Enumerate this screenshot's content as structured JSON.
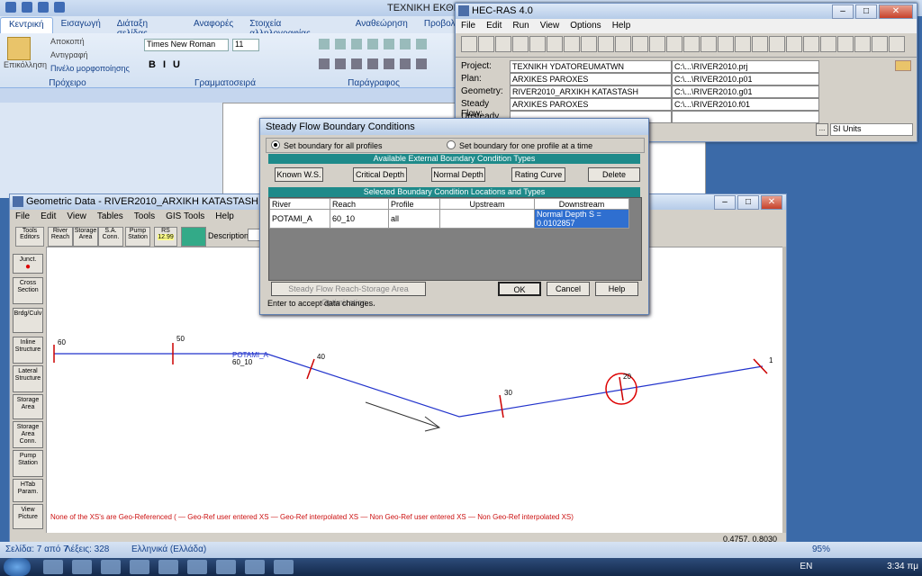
{
  "word": {
    "title": "ΤΕΧΝΙΚΗ ΕΚΘΕΣΗ",
    "tabs": [
      "Κεντρική",
      "Εισαγωγή",
      "Διάταξη σελίδας",
      "Αναφορές",
      "Στοιχεία αλληλογραφίας",
      "Αναθεώρηση",
      "Προβολή"
    ],
    "clipboard": {
      "paste": "Επικόλληση",
      "cut": "Αποκοπή",
      "copy": "Αντιγραφή",
      "format_painter": "Πινέλο μορφοποίησης",
      "group": "Πρόχειρο"
    },
    "font": {
      "name": "Times New Roman",
      "size": "11",
      "group": "Γραμματοσειρά"
    },
    "paragraph_group": "Παράγραφος",
    "status": {
      "page": "Σελίδα: 7 από 7",
      "words": "Λέξεις: 328",
      "lang": "Ελληνικά (Ελλάδα)",
      "zoom": "95%"
    }
  },
  "taskbar": {
    "lang": "EN",
    "clock": "3:34 πμ"
  },
  "hec": {
    "title": "HEC-RAS 4.0",
    "menu": [
      "File",
      "Edit",
      "Run",
      "View",
      "Options",
      "Help"
    ],
    "rows": [
      {
        "label": "Project:",
        "value": "ΤΕΧΝΙΚΗ YDATOREUMATWN",
        "path": "C:\\...\\RIVER2010.prj"
      },
      {
        "label": "Plan:",
        "value": "ARXIKES PAROXES",
        "path": "C:\\...\\RIVER2010.p01"
      },
      {
        "label": "Geometry:",
        "value": "RIVER2010_ARXIKH KATASTASH",
        "path": "C:\\...\\RIVER2010.g01"
      },
      {
        "label": "Steady Flow:",
        "value": "ARXIKES PAROXES",
        "path": "C:\\...\\RIVER2010.f01"
      },
      {
        "label": "Unsteady Flow:",
        "value": "",
        "path": ""
      }
    ],
    "units": "SI Units"
  },
  "geo": {
    "title": "Geometric Data - RIVER2010_ARXIKH KATASTASH",
    "menu": [
      "File",
      "Edit",
      "View",
      "Tables",
      "Tools",
      "GIS Tools",
      "Help"
    ],
    "tools": [
      "Tools",
      "Editors",
      "River Reach",
      "Storage Area",
      "S.A. Conn.",
      "Pump Station",
      "RS"
    ],
    "rs_value": "12.99",
    "description_label": "Description :",
    "side_buttons": [
      "Junct.",
      "Cross Section",
      "Brdg/Culv",
      "Inline Structure",
      "Lateral Structure",
      "Storage Area",
      "Storage Area Conn.",
      "Pump Station",
      "HTab Param.",
      "View Picture"
    ],
    "stations": [
      "60",
      "50",
      "40",
      "30",
      "20",
      "1"
    ],
    "river_label": "POTAMI_A",
    "reach_label": "60_10",
    "legend": "None of the XS's are Geo-Referenced ( — Geo-Ref user entered XS  — Geo-Ref interpolated XS  — Non Geo-Ref user entered XS  — Non Geo-Ref interpolated XS)",
    "coords": "0.4757, 0.8030"
  },
  "dialog": {
    "title": "Steady Flow Boundary Conditions",
    "radio_all": "Set boundary for all profiles",
    "radio_one": "Set boundary for one profile at a time",
    "available_header": "Available External Boundary Condition Types",
    "buttons": [
      "Known W.S.",
      "Critical Depth",
      "Normal Depth",
      "Rating Curve",
      "Delete"
    ],
    "selected_header": "Selected Boundary Condition Locations and Types",
    "columns": [
      "River",
      "Reach",
      "Profile",
      "Upstream",
      "Downstream"
    ],
    "row": {
      "river": "POTAMI_A",
      "reach": "60_10",
      "profile": "all",
      "upstream": "",
      "downstream": "Normal Depth S = 0.0102857"
    },
    "optimization": "Steady Flow Reach-Storage Area Optimization ...",
    "ok": "OK",
    "cancel": "Cancel",
    "help": "Help",
    "status": "Enter to accept data changes."
  }
}
